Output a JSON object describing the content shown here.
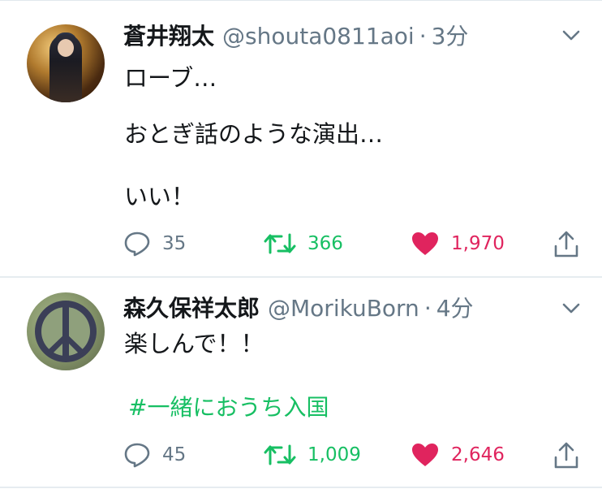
{
  "tweets": [
    {
      "display_name": "蒼井翔太",
      "handle": "@shouta0811aoi",
      "separator": "·",
      "time": "3分",
      "lines": [
        "ローブ…",
        "おとぎ話のような演出…",
        "いい！"
      ],
      "hashtag": "",
      "replies": "35",
      "retweets": "366",
      "likes": "1,970",
      "avatar_icon": "user-photo-avatar"
    },
    {
      "display_name": "森久保祥太郎",
      "handle": "@MorikuBorn",
      "separator": "·",
      "time": "4分",
      "lines": [
        "楽しんで！！"
      ],
      "hashtag": "#一緒におうち入国",
      "replies": "45",
      "retweets": "1,009",
      "likes": "2,646",
      "avatar_icon": "peace-sign-avatar"
    }
  ],
  "icons": {
    "reply": "reply-icon",
    "retweet": "retweet-icon",
    "like": "heart-icon",
    "share": "share-icon",
    "menu": "chevron-down-icon"
  },
  "colors": {
    "text": "#14171a",
    "secondary": "#657786",
    "retweet_green": "#17bf63",
    "like_red": "#e0245e",
    "hashtag_green": "#17bf63",
    "divider": "#e6ecf0"
  }
}
